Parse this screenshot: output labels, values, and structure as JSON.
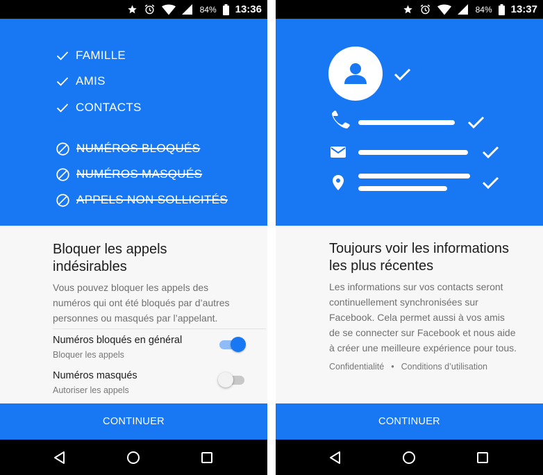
{
  "left": {
    "status": {
      "battery": "84%",
      "time": "13:36"
    },
    "allowed": [
      "FAMILLE",
      "AMIS",
      "CONTACTS"
    ],
    "blocked": [
      "NUMÉROS BLOQUÉS",
      "NUMÉROS MASQUÉS",
      "APPELS NON SOLLICITÉS"
    ],
    "title_line1": "Bloquer les appels",
    "title_line2": "indésirables",
    "desc_line1": "Vous pouvez bloquer les appels des",
    "desc_line2": "numéros qui ont été bloqués par d’autres",
    "desc_line3": "personnes ou masqués par l’appelant.",
    "settings": [
      {
        "label": "Numéros bloqués en général",
        "sub": "Bloquer les appels",
        "enabled": true
      },
      {
        "label": "Numéros masqués",
        "sub": "Autoriser les appels",
        "enabled": false
      }
    ],
    "continue_label": "CONTINUER"
  },
  "right": {
    "status": {
      "battery": "84%",
      "time": "13:37"
    },
    "title_line1": "Toujours voir les informations",
    "title_line2": "les plus récentes",
    "desc_line1": "Les informations sur vos contacts seront",
    "desc_line2": "continuellement synchronisées sur",
    "desc_line3": "Facebook. Cela permet aussi à vos amis",
    "desc_line4": "de se connecter sur Facebook et nous aide",
    "desc_line5": "à créer une meilleure expérience pour tous.",
    "link_privacy": "Confidentialité",
    "link_separator": "•",
    "link_terms": "Conditions d’utilisation",
    "continue_label": "CONTINUER"
  },
  "colors": {
    "accent": "#1877f2",
    "hero_text": "#ffffff",
    "nav_bar": "#000000"
  },
  "icons": {
    "status": [
      "star-icon",
      "alarm-icon",
      "wifi-icon",
      "signal-icon",
      "battery-icon"
    ],
    "nav": [
      "back-icon",
      "home-icon",
      "recents-icon"
    ],
    "hero_left": [
      "check-icon",
      "block-icon"
    ],
    "hero_right": [
      "person-icon",
      "phone-icon",
      "mail-icon",
      "location-icon",
      "check-icon"
    ]
  }
}
